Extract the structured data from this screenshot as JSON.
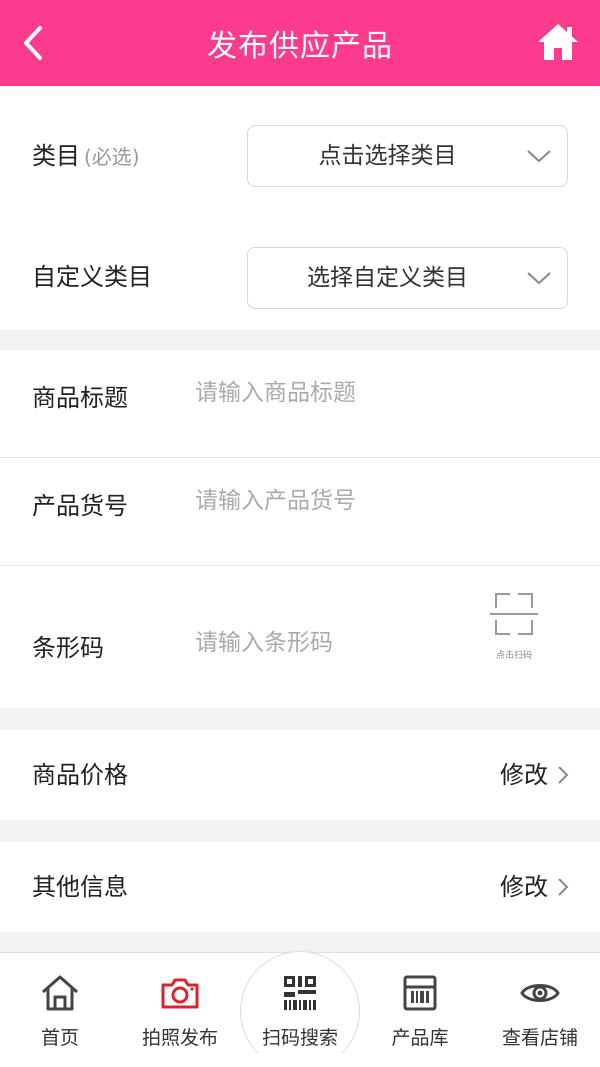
{
  "header": {
    "title": "发布供应产品"
  },
  "category": {
    "label": "类目",
    "hint": "(必选)",
    "select_text": "点击选择类目"
  },
  "custom_category": {
    "label": "自定义类目",
    "select_text": "选择自定义类目"
  },
  "fields": {
    "title": {
      "label": "商品标题",
      "placeholder": "请输入商品标题"
    },
    "sku": {
      "label": "产品货号",
      "placeholder": "请输入产品货号"
    },
    "barcode": {
      "label": "条形码",
      "placeholder": "请输入条形码",
      "scan_label": "点击扫码"
    }
  },
  "price": {
    "label": "商品价格",
    "action": "修改"
  },
  "other": {
    "label": "其他信息",
    "action": "修改"
  },
  "tabbar": {
    "items": [
      {
        "label": "首页",
        "icon": "home-icon"
      },
      {
        "label": "拍照发布",
        "icon": "camera-icon"
      },
      {
        "label": "扫码搜索",
        "icon": "qr-code-icon"
      },
      {
        "label": "产品库",
        "icon": "product-library-icon"
      },
      {
        "label": "查看店铺",
        "icon": "eye-icon"
      }
    ]
  },
  "colors": {
    "accent": "#fc3a8e",
    "camera": "#d8232a",
    "icon": "#444444"
  }
}
